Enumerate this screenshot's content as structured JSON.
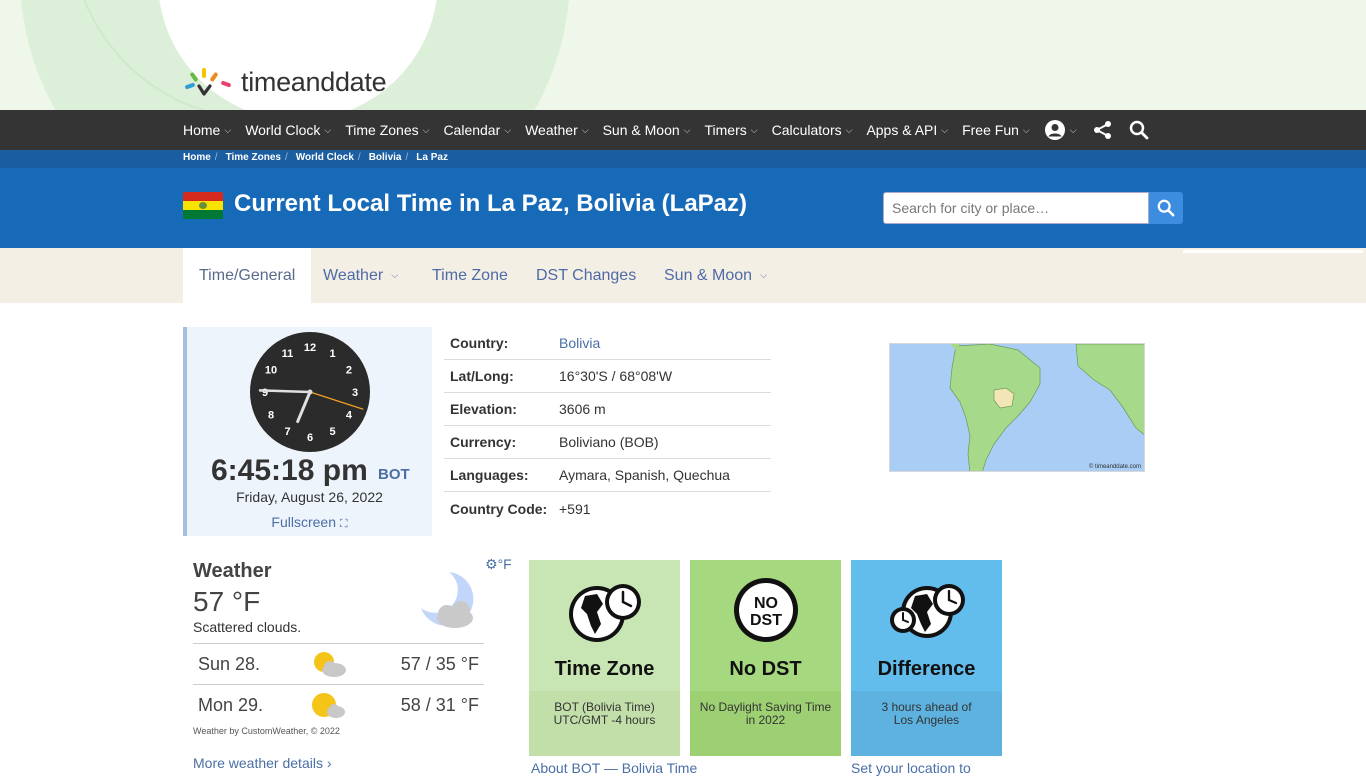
{
  "brand": {
    "name": "timeanddate"
  },
  "nav": {
    "items": [
      "Home",
      "World Clock",
      "Time Zones",
      "Calendar",
      "Weather",
      "Sun & Moon",
      "Timers",
      "Calculators",
      "Apps & API",
      "Free Fun"
    ]
  },
  "breadcrumb": [
    "Home",
    "Time Zones",
    "World Clock",
    "Bolivia",
    "La Paz"
  ],
  "headline": {
    "title": "Current Local Time in La Paz, Bolivia (LaPaz)"
  },
  "search": {
    "placeholder": "Search for city or place…"
  },
  "tabs": [
    {
      "label": "Time/General"
    },
    {
      "label": "Weather"
    },
    {
      "label": "Time Zone"
    },
    {
      "label": "DST Changes"
    },
    {
      "label": "Sun & Moon"
    }
  ],
  "clock": {
    "numbers": [
      "12",
      "1",
      "2",
      "3",
      "4",
      "5",
      "6",
      "7",
      "8",
      "9",
      "10",
      "11"
    ],
    "time": "6:45:18 pm",
    "tz": "BOT",
    "date": "Friday, August 26, 2022",
    "fullscreen": "Fullscreen",
    "hour": 6,
    "minute": 45,
    "second": 18
  },
  "info": [
    {
      "key": "Country:",
      "value": "Bolivia",
      "link": true
    },
    {
      "key": "Lat/Long:",
      "value": "16°30'S / 68°08'W"
    },
    {
      "key": "Elevation:",
      "value": "3606 m"
    },
    {
      "key": "Currency:",
      "value": "Boliviano (BOB)"
    },
    {
      "key": "Languages:",
      "value": "Aymara, Spanish, Quechua"
    },
    {
      "key": "Country Code:",
      "value": "+591"
    }
  ],
  "map": {
    "copyright": "© timeanddate.com"
  },
  "weather": {
    "title": "Weather",
    "unit": "°F",
    "temp": "57 °F",
    "desc": "Scattered clouds.",
    "forecast": [
      {
        "day": "Sun 28.",
        "temps": "57 / 35 °F"
      },
      {
        "day": "Mon 29.",
        "temps": "58 / 31 °F"
      }
    ],
    "credit": "Weather by CustomWeather, © 2022",
    "more": "More weather details"
  },
  "tiles": [
    {
      "title": "Time Zone",
      "line1": "BOT (Bolivia Time)",
      "line2": "UTC/GMT -4 hours",
      "color_top": "#c8e6b3",
      "color_bottom": "#c2dea9",
      "link": "About BOT — Bolivia Time"
    },
    {
      "title": "No DST",
      "line1": "No Daylight Saving Time",
      "line2": "in 2022",
      "color_top": "#a6d97f",
      "color_bottom": "#9dd072",
      "link": ""
    },
    {
      "title": "Difference",
      "line1": "3 hours ahead of",
      "line2": "Los Angeles",
      "color_top": "#62bcec",
      "color_bottom": "#5eb2e0",
      "link": "Set your location to"
    }
  ]
}
